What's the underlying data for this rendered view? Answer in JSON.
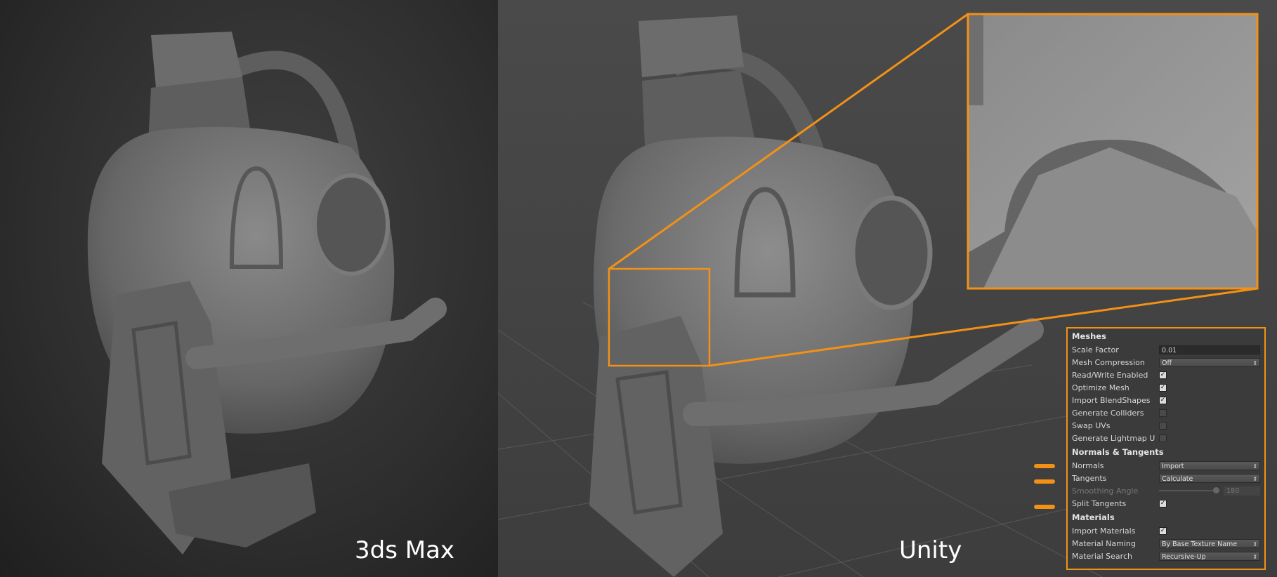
{
  "labels": {
    "left_render": "3ds Max",
    "right_render": "Unity"
  },
  "colors": {
    "accent_orange": "#f39116",
    "panel_bg": "#3b3b3b"
  },
  "inspector": {
    "meshes_header": "Meshes",
    "scale_factor_label": "Scale Factor",
    "scale_factor_value": "0.01",
    "mesh_compression_label": "Mesh Compression",
    "mesh_compression_value": "Off",
    "read_write_label": "Read/Write Enabled",
    "read_write_checked": true,
    "optimize_mesh_label": "Optimize Mesh",
    "optimize_mesh_checked": true,
    "import_blendshapes_label": "Import BlendShapes",
    "import_blendshapes_checked": true,
    "generate_colliders_label": "Generate Colliders",
    "generate_colliders_checked": false,
    "swap_uvs_label": "Swap UVs",
    "swap_uvs_checked": false,
    "generate_lightmap_label": "Generate Lightmap UVs",
    "generate_lightmap_checked": false,
    "normals_header": "Normals & Tangents",
    "normals_label": "Normals",
    "normals_value": "Import",
    "tangents_label": "Tangents",
    "tangents_value": "Calculate",
    "smoothing_angle_label": "Smoothing Angle",
    "smoothing_angle_value": "180",
    "split_tangents_label": "Split Tangents",
    "split_tangents_checked": true,
    "materials_header": "Materials",
    "import_materials_label": "Import Materials",
    "import_materials_checked": true,
    "material_naming_label": "Material Naming",
    "material_naming_value": "By Base Texture Name",
    "material_search_label": "Material Search",
    "material_search_value": "Recursive-Up",
    "checkmark": "✓"
  }
}
